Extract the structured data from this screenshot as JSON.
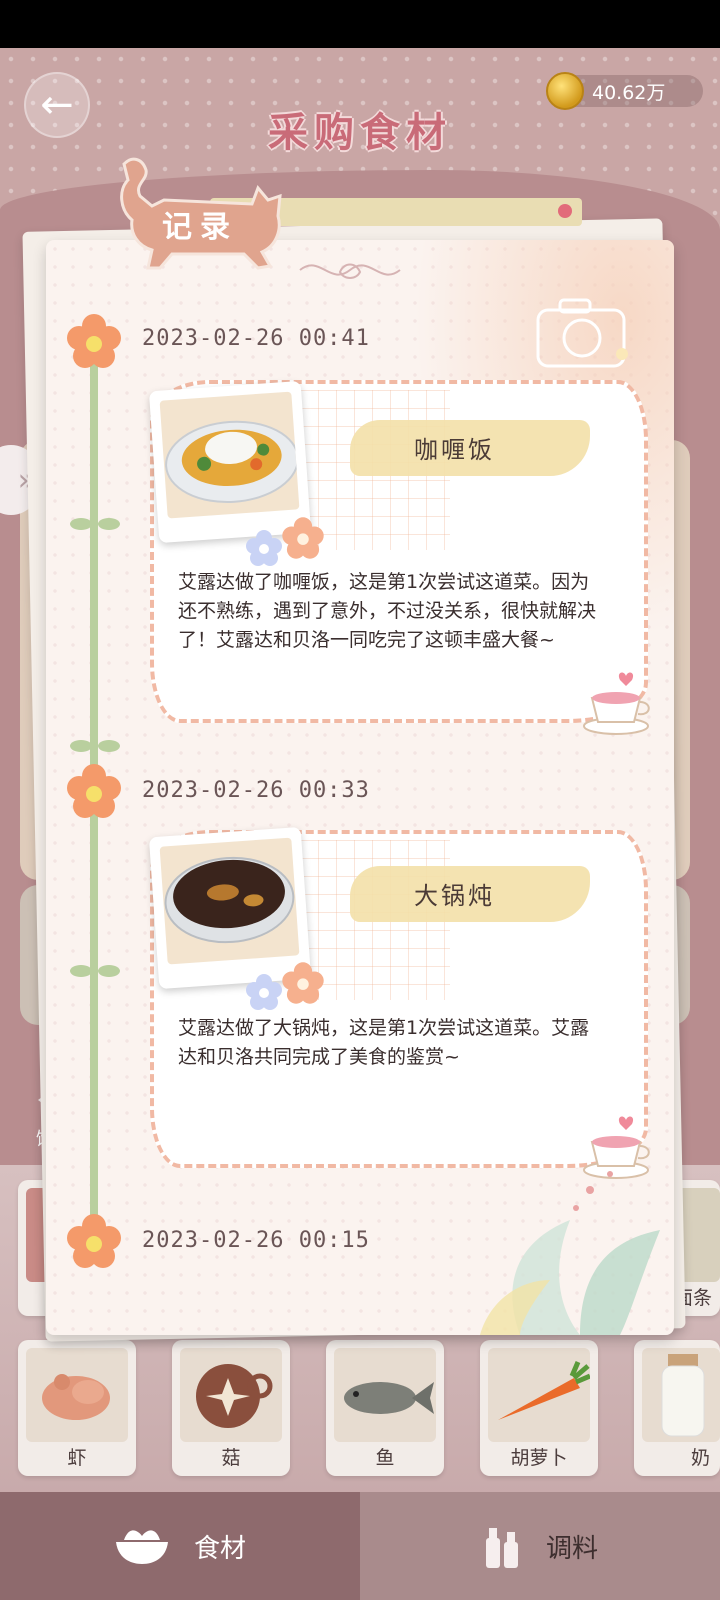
{
  "header": {
    "title": "采购食材",
    "coins": "40.62万"
  },
  "record_tab": {
    "label": "记录"
  },
  "entries": [
    {
      "date": "2023-02-26 00:41",
      "dish": "咖喱饭",
      "text": "艾露达做了咖喱饭，这是第1次尝试这道菜。因为还不熟练，遇到了意外，不过没关系，很快就解决了！艾露达和贝洛一同吃完了这顿丰盛大餐~"
    },
    {
      "date": "2023-02-26 00:33",
      "dish": "大锅炖",
      "text": "艾露达做了大锅炖，这是第1次尝试这道菜。艾露达和贝洛共同完成了美食的鉴赏~"
    },
    {
      "date": "2023-02-26 00:15"
    }
  ],
  "side": {
    "label": "饭"
  },
  "ingredients_top": [
    {
      "label": ""
    },
    {
      "label": "面条"
    }
  ],
  "ingredients": [
    {
      "label": "虾"
    },
    {
      "label": "菇"
    },
    {
      "label": "鱼"
    },
    {
      "label": "胡萝卜"
    },
    {
      "label": "奶"
    }
  ],
  "tabs": [
    {
      "label": "食材"
    },
    {
      "label": "调料"
    }
  ],
  "colors": {
    "accent": "#c96b78",
    "stem": "#b9cf9e",
    "note_border": "#f1b9a4"
  }
}
